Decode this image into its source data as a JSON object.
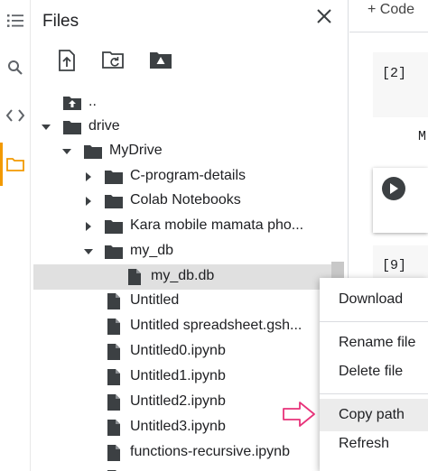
{
  "panel": {
    "title": "Files",
    "toolbar": {
      "upload_icon": "upload-file-icon",
      "refresh_icon": "folder-refresh-icon",
      "drive_icon": "mount-drive-icon"
    }
  },
  "rail": {
    "items": [
      "toc-icon",
      "search-icon",
      "code-snippets-icon",
      "folder-icon"
    ],
    "active_color": "#f29900"
  },
  "tree": {
    "parent": "..",
    "drive": "drive",
    "mydrive": "MyDrive",
    "folders": [
      "C-program-details",
      "Colab Notebooks",
      "Kara mobile mamata pho..."
    ],
    "my_db_folder": "my_db",
    "selected_file": "my_db.db",
    "files": [
      "Untitled",
      "Untitled spreadsheet.gsh...",
      "Untitled0.ipynb",
      "Untitled1.ipynb",
      "Untitled2.ipynb",
      "Untitled3.ipynb",
      "functions-recursive.ipynb"
    ]
  },
  "notebook": {
    "add_code": "+ Code",
    "cell_1_label": "[2]",
    "cell_1_text": "M",
    "cell_2_label": "[9]"
  },
  "context_menu": {
    "download": "Download",
    "rename": "Rename file",
    "delete": "Delete file",
    "copy_path": "Copy path",
    "refresh": "Refresh"
  },
  "colors": {
    "selected_row": "#e0e0e0",
    "menu_highlight": "#ececec",
    "arrow": "#e8337a"
  }
}
